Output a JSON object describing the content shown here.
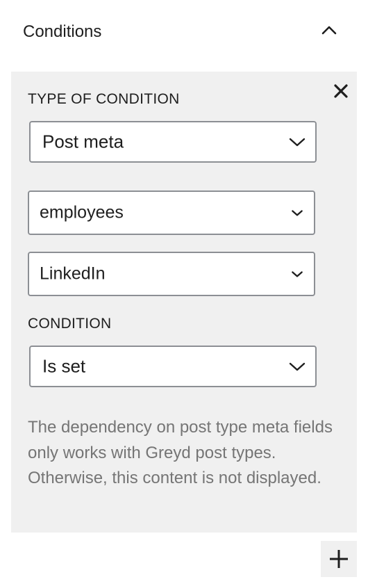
{
  "panel": {
    "title": "Conditions",
    "collapse_icon": "chevron-up-icon"
  },
  "condition_card": {
    "remove_icon": "close-icon",
    "type_label": "TYPE OF CONDITION",
    "type_select": {
      "value": "Post meta",
      "icon": "chevron-down-icon"
    },
    "post_type_select": {
      "value": "employees",
      "icon": "chevron-down-icon"
    },
    "meta_field_select": {
      "value": "LinkedIn",
      "icon": "chevron-down-icon"
    },
    "condition_label": "CONDITION",
    "condition_select": {
      "value": "Is set",
      "icon": "chevron-down-icon"
    },
    "help_text": "The dependency on post type meta fields only works with Greyd post types. Otherwise, this content is not displayed."
  },
  "add_button": {
    "icon": "plus-icon"
  },
  "colors": {
    "card_background": "#f0f0f0",
    "text": "#1e1e1e",
    "help_text": "#757575",
    "border": "#8c8f94"
  }
}
